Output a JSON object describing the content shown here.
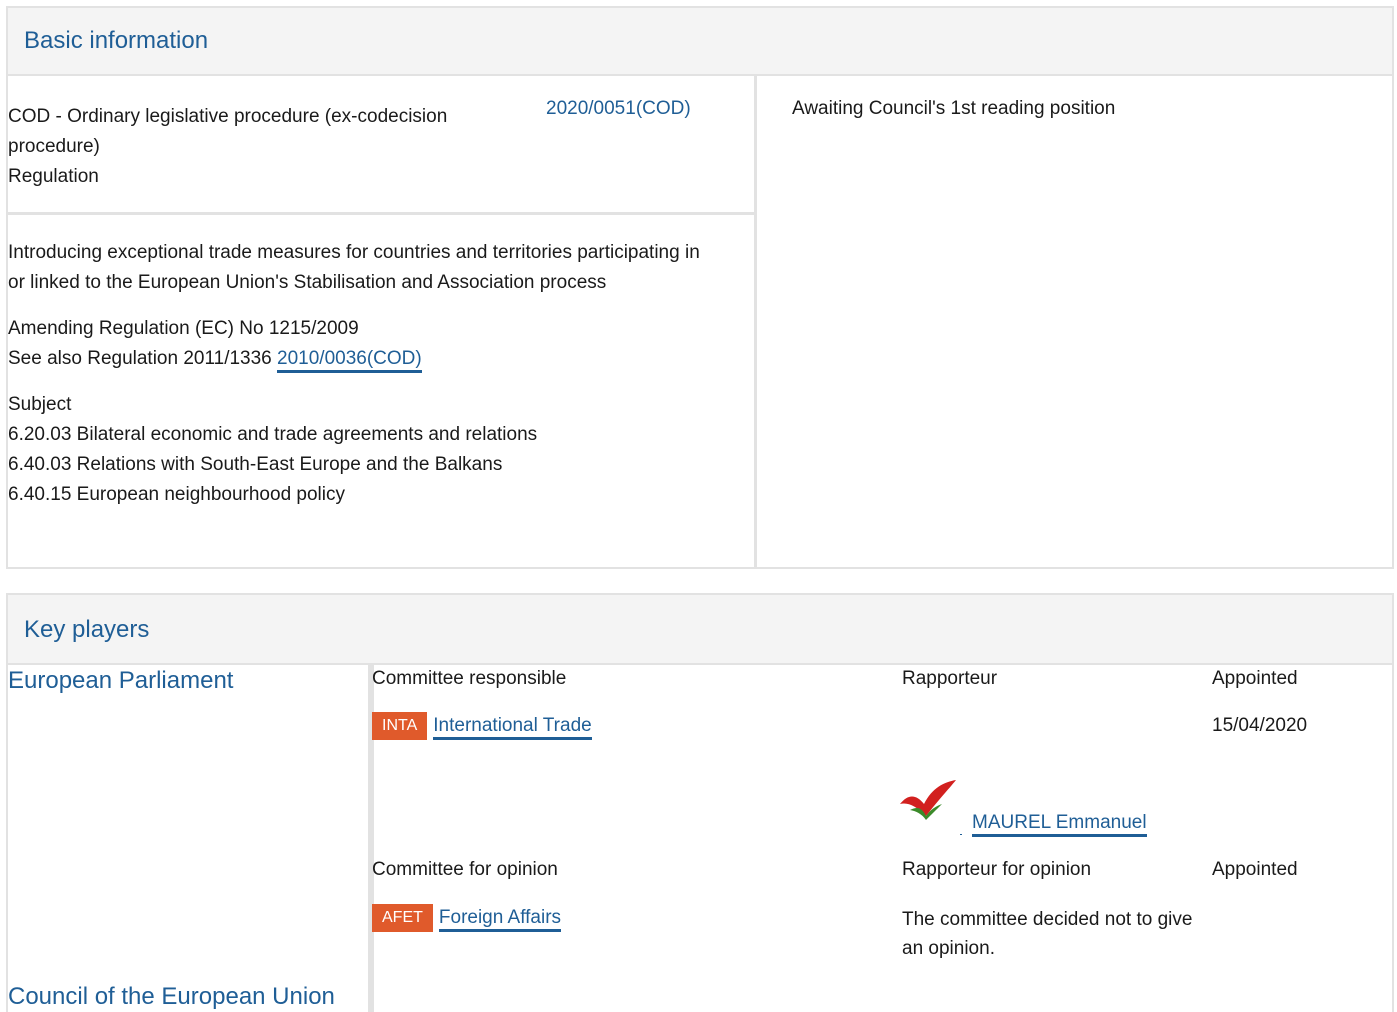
{
  "basic_info": {
    "header": "Basic information",
    "procedure_type": "COD - Ordinary legislative procedure (ex-codecision procedure)",
    "legal_instrument": "Regulation",
    "reference": "2020/0051(COD)",
    "status": "Awaiting Council's 1st reading position",
    "title": "Introducing exceptional trade measures for countries and territories participating in or linked to the European Union's Stabilisation and Association process",
    "amending": "Amending  Regulation (EC) No 1215/2009",
    "see_also_prefix": "See also Regulation 2011/1336",
    "see_also_link": "2010/0036(COD)",
    "subject_label": "Subject",
    "subjects": [
      "6.20.03 Bilateral economic and trade agreements and relations",
      "6.40.03 Relations with South-East Europe and the Balkans",
      "6.40.15 European neighbourhood policy"
    ]
  },
  "key_players": {
    "header": "Key players",
    "institutions": [
      "European Parliament",
      "Council of the European Union"
    ],
    "responsible": {
      "label": "Committee responsible",
      "rapporteur_label": "Rapporteur",
      "appointed_label": "Appointed",
      "committee_code": "INTA",
      "committee_name": "International Trade",
      "appointed_date": "15/04/2020",
      "rapporteur_name": "MAUREL Emmanuel"
    },
    "opinion": {
      "label": "Committee for opinion",
      "rapporteur_label": "Rapporteur for opinion",
      "appointed_label": "Appointed",
      "committee_code": "AFET",
      "committee_name": "Foreign Affairs",
      "note": "The committee decided not to give an opinion."
    }
  },
  "colors": {
    "link": "#1f5e96",
    "badge": "#e05a2b",
    "border": "#e2e2e2",
    "header_bg": "#f4f4f4"
  }
}
